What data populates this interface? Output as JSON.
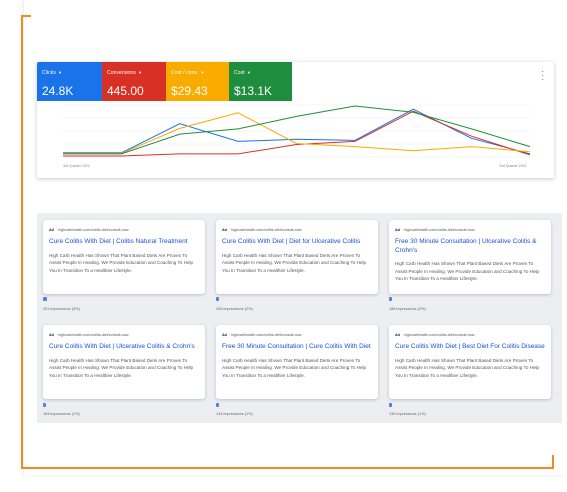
{
  "metrics": [
    {
      "label": "Clicks",
      "value": "24.8K",
      "color": "#1a73e8"
    },
    {
      "label": "Conversions",
      "value": "445.00",
      "color": "#d93025"
    },
    {
      "label": "Cost / conv.",
      "value": "$29.43",
      "color": "#f9ab00"
    },
    {
      "label": "Cost",
      "value": "$13.1K",
      "color": "#1e8e3e"
    }
  ],
  "chart": {
    "x_start_label": "3rd Quarter 2022",
    "x_end_label": "2nd Quarter 2023"
  },
  "chart_data": {
    "type": "line",
    "x": [
      0,
      1,
      2,
      3,
      4,
      5,
      6,
      7,
      8
    ],
    "ylim": [
      0,
      1
    ],
    "series": [
      {
        "name": "Clicks",
        "color": "#1a73e8",
        "values": [
          0.08,
          0.08,
          0.64,
          0.3,
          0.34,
          0.32,
          0.92,
          0.36,
          0.06
        ]
      },
      {
        "name": "Conversions",
        "color": "#d93025",
        "values": [
          0.02,
          0.02,
          0.06,
          0.06,
          0.24,
          0.3,
          0.88,
          0.4,
          0.04
        ]
      },
      {
        "name": "Cost / conv.",
        "color": "#f9ab00",
        "values": [
          0.07,
          0.07,
          0.55,
          0.85,
          0.26,
          0.2,
          0.12,
          0.2,
          0.1
        ]
      },
      {
        "name": "Cost",
        "color": "#1e8e3e",
        "values": [
          0.06,
          0.06,
          0.44,
          0.54,
          0.78,
          0.98,
          0.86,
          0.54,
          0.2
        ]
      }
    ],
    "grid": true
  },
  "ads": [
    {
      "ad_label": "Ad",
      "url": "highcarbhealth.com/colitis-diet/consult-now",
      "title": "Cure Colitis With Diet | Colitis Natural Treatment",
      "description": "High Carb Health Has Shown That Plant Based Diets Are Proven To Assist People In Healing. We Provide Education and Coaching To Help You In Transition To a Healthier Lifestyle.",
      "impressions": "251 impressions (3%)",
      "share": 0.03
    },
    {
      "ad_label": "Ad",
      "url": "highcarbhealth.com/colitis-diet/consult-now",
      "title": "Cure Colitis With Diet | Diet for Ulcerative Colitis",
      "description": "High Carb Health Has Shown That Plant Based Diets Are Proven To Assist People In Healing. We Provide Education and Coaching To Help You In Transition To a Healthier Lifestyle.",
      "impressions": "206 impressions (2%)",
      "share": 0.02
    },
    {
      "ad_label": "Ad",
      "url": "highcarbhealth.com/colitis-diet/consult-now",
      "title": "Free 30 Minute Consultation | Ulcerative Colitis & Crohn's",
      "description": "High Carb Health Has Shown That Plant Based Diets Are Proven To Assist People In Healing. We Provide Education and Coaching To Help You In Transition To a Healthier Lifestyle.",
      "impressions": "188 impressions (2%)",
      "share": 0.02
    },
    {
      "ad_label": "Ad",
      "url": "highcarbhealth.com/colitis-diet/consult-now",
      "title": "Cure Colitis With Diet | Ulcerative Colitis & Crohn's",
      "description": "High Carb Health Has Shown That Plant Based Diets Are Proven To Assist People In Healing. We Provide Education and Coaching To Help You In Transition To a Healthier Lifestyle.",
      "impressions": "183 impressions (1%)",
      "share": 0.01
    },
    {
      "ad_label": "Ad",
      "url": "highcarbhealth.com/colitis-diet/consult-now",
      "title": "Free 30 Minute Consultation | Cure Colitis With Diet",
      "description": "High Carb Health Has Shown That Plant Based Diets Are Proven To Assist People In Healing. We Provide Education and Coaching To Help You In Transition To a Healthier Lifestyle.",
      "impressions": "144 impressions (1%)",
      "share": 0.01
    },
    {
      "ad_label": "Ad",
      "url": "highcarbhealth.com/colitis-diet/consult-now",
      "title": "Cure Colitis With Diet | Best Diet For Colitis Disease",
      "description": "High Carb Health Has Shown That Plant Based Diets Are Proven To Assist People In Healing. We Provide Education and Coaching To Help You In Transition To a Healthier Lifestyle.",
      "impressions": "135 impressions (1%)",
      "share": 0.01
    }
  ]
}
